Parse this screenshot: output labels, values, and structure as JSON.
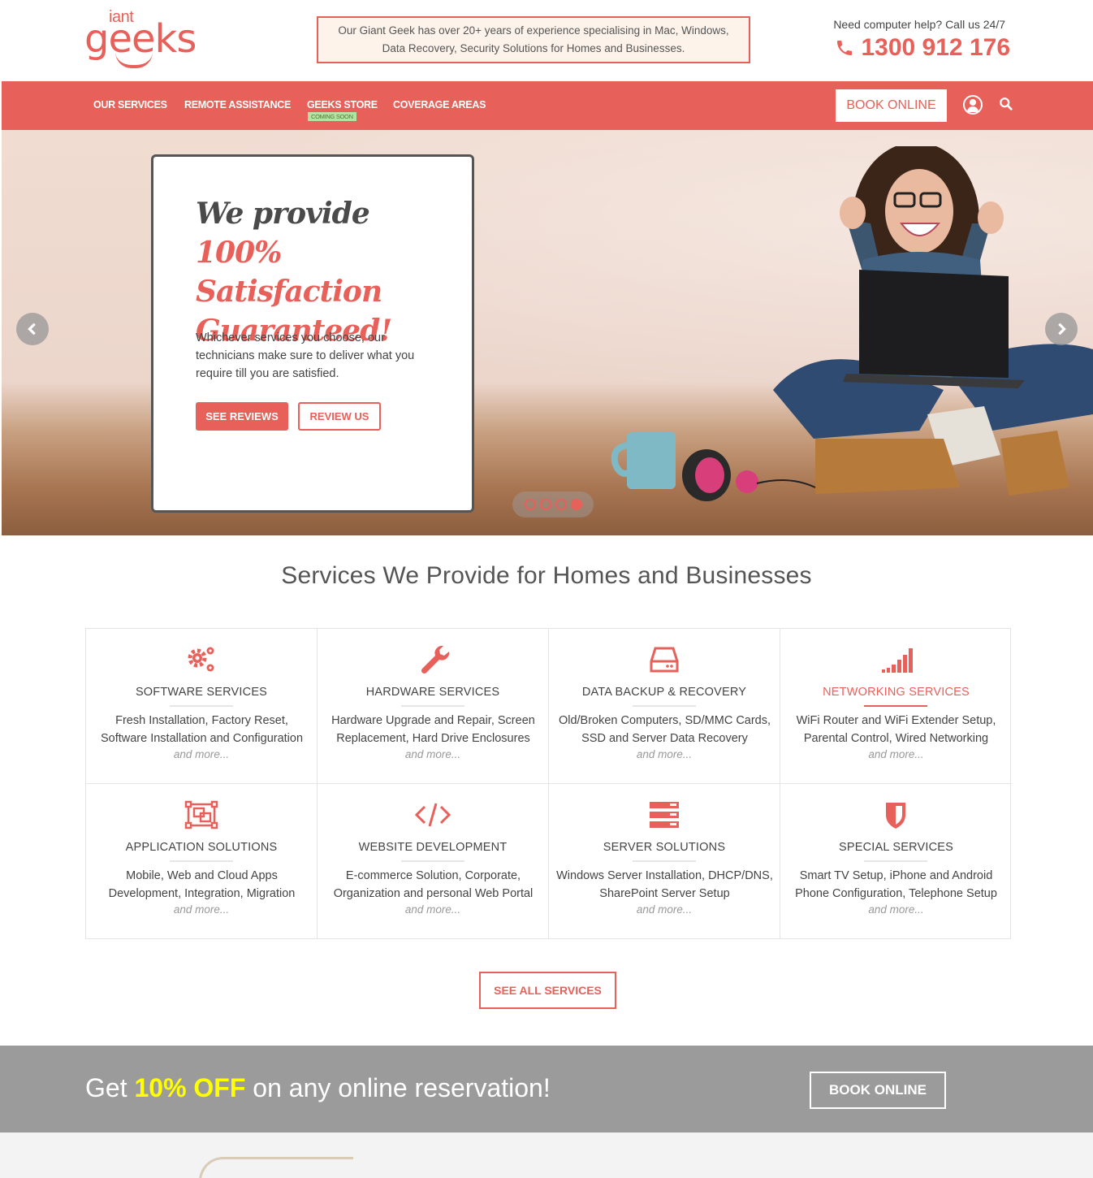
{
  "brand": {
    "logo_small": "iant",
    "logo_big": "geeks",
    "intro_line1": "Our Giant Geek has over 20+ years of experience specialising in Mac, Windows,",
    "intro_line2": "Data Recovery, Security Solutions for Homes and Businesses.",
    "call_label": "Need computer help? Call us 24/7",
    "phone": "1300 912 176"
  },
  "nav": {
    "items": [
      {
        "label": "OUR SERVICES"
      },
      {
        "label": "REMOTE ASSISTANCE"
      },
      {
        "label": "GEEKS STORE",
        "badge": "COMING SOON"
      },
      {
        "label": "COVERAGE AREAS"
      }
    ],
    "book_label": "BOOK ONLINE",
    "user_icon": "user-circle-icon",
    "search_icon": "search-icon"
  },
  "hero": {
    "title_dark": "We provide ",
    "title_red_1": "100%",
    "title_red_2": "Satisfaction",
    "title_red_3": "Guaranteed!",
    "description": "Whichever services you choose, our technicians make sure to deliver what you require till you are satisfied.",
    "btn_reviews": "SEE REVIEWS",
    "btn_review_us": "REVIEW US",
    "slides_total": 4,
    "active_slide": 4
  },
  "services": {
    "title": "Services We Provide for Homes and Businesses",
    "more": "and more...",
    "items": [
      {
        "icon": "gears-icon",
        "title": "SOFTWARE SERVICES",
        "desc": "Fresh Installation, Factory Reset, Software Installation and Configuration"
      },
      {
        "icon": "wrench-icon",
        "title": "HARDWARE SERVICES",
        "desc": "Hardware Upgrade and Repair, Screen Replacement, Hard Drive Enclosures"
      },
      {
        "icon": "hard-drive-icon",
        "title": "DATA BACKUP & RECOVERY",
        "desc": "Old/Broken Computers, SD/MMC Cards, SSD and Server Data Recovery"
      },
      {
        "icon": "signal-bars-icon",
        "title": "NETWORKING SERVICES",
        "desc": "WiFi Router and WiFi Extender Setup, Parental Control, Wired Networking"
      },
      {
        "icon": "object-group-icon",
        "title": "APPLICATION SOLUTIONS",
        "desc": "Mobile, Web and Cloud Apps Development, Integration, Migration"
      },
      {
        "icon": "code-icon",
        "title": "WEBSITE DEVELOPMENT",
        "desc": "E-commerce Solution, Corporate, Organization and personal Web Portal"
      },
      {
        "icon": "server-icon",
        "title": "SERVER SOLUTIONS",
        "desc": "Windows Server Installation, DHCP/DNS, SharePoint Server Setup"
      },
      {
        "icon": "shield-icon",
        "title": "SPECIAL SERVICES",
        "desc": "Smart TV Setup, iPhone and Android Phone Configuration, Telephone Setup"
      }
    ],
    "see_all": "SEE ALL SERVICES"
  },
  "promo": {
    "pre": "Get ",
    "highlight": "10% OFF",
    "post": " on any online reservation!",
    "button": "BOOK ONLINE"
  },
  "colors": {
    "accent": "#e8605a",
    "promo_bg": "#9b9b9b",
    "highlight": "#ffff00"
  }
}
